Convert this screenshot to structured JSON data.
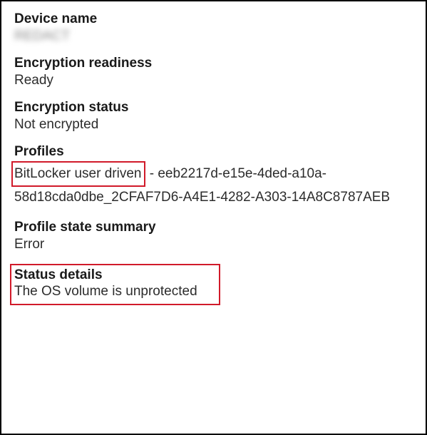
{
  "device_name": {
    "label": "Device name",
    "value": "REDACT"
  },
  "encryption_readiness": {
    "label": "Encryption readiness",
    "value": "Ready"
  },
  "encryption_status": {
    "label": "Encryption status",
    "value": "Not encrypted"
  },
  "profiles": {
    "label": "Profiles",
    "highlighted_name": "BitLocker user driven",
    "separator": " - ",
    "guid": "eeb2217d-e15e-4ded-a10a-58d18cda0dbe_2CFAF7D6-A4E1-4282-A303-14A8C8787AEB"
  },
  "profile_state_summary": {
    "label": "Profile state summary",
    "value": "Error"
  },
  "status_details": {
    "label": "Status details",
    "value": "The OS volume is unprotected"
  }
}
